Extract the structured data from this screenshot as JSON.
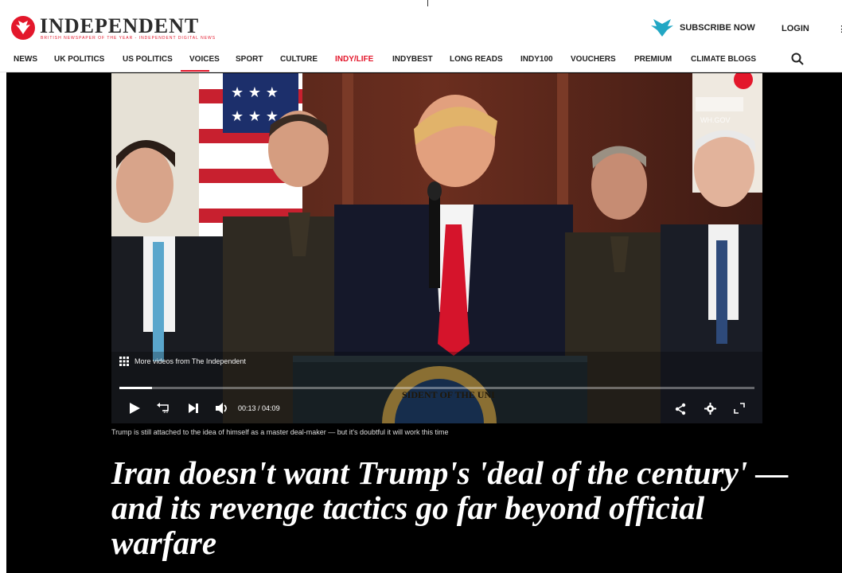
{
  "site": {
    "logo_text": "INDEPENDENT",
    "logo_tagline": "BRITISH NEWSPAPER OF THE YEAR - INDEPENDENT DIGITAL NEWS",
    "brand_color": "#e3172b",
    "subscribe_label": "SUBSCRIBE NOW",
    "login_label": "LOGIN"
  },
  "nav": {
    "items": [
      "NEWS",
      "UK POLITICS",
      "US POLITICS",
      "VOICES",
      "SPORT",
      "CULTURE",
      "INDY/LIFE",
      "INDYBEST",
      "LONG READS",
      "INDY100",
      "VOUCHERS",
      "PREMIUM",
      "CLIMATE BLOGS"
    ],
    "active": "VOICES"
  },
  "video": {
    "more_videos_label": "More videos from The Independent",
    "current_time": "00:13",
    "duration": "04:09",
    "progress_fraction": 0.052,
    "watermark": "WH.GOV",
    "seal_text": "SIDENT OF THE UNI"
  },
  "article": {
    "caption": "Trump is still attached to the idea of himself as a master deal-maker — but it's doubtful it will work this time",
    "headline": "Iran doesn't want Trump's 'deal of the century' — and its revenge tactics go far beyond official warfare"
  }
}
